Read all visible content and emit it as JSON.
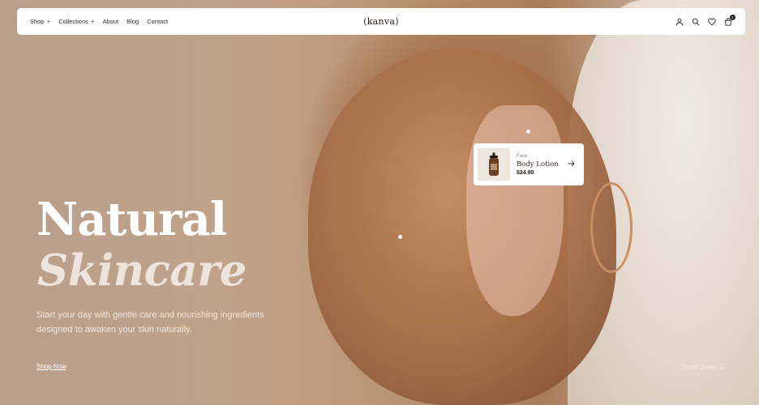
{
  "nav": {
    "logo": "(kanva)",
    "links": [
      {
        "label": "Shop",
        "has_submenu": true
      },
      {
        "label": "Collections",
        "has_submenu": true
      },
      {
        "label": "About",
        "has_submenu": false
      },
      {
        "label": "Blog",
        "has_submenu": false
      },
      {
        "label": "Contact",
        "has_submenu": false
      }
    ],
    "submenu_indicator": "+",
    "icons": [
      "user-icon",
      "search-icon",
      "heart-icon",
      "cart-icon"
    ],
    "cart_count": "1"
  },
  "hero": {
    "title_line1": "Natural",
    "title_line2": "Skincare",
    "subtitle": "Start your day with gentle care and nourishing ingredients designed to awaken your skin naturally.",
    "cta_label": "Shop Now",
    "scroll_label": "Scroll Down",
    "scroll_icon": "arrow-down-icon"
  },
  "product_card": {
    "category": "Face",
    "name": "Body Lotion",
    "price": "$24.90",
    "arrow_icon": "arrow-right-icon"
  },
  "colors": {
    "nav_bg": "#ffffff",
    "title_primary": "#ffffff",
    "title_italic": "#ece4dd",
    "text_dark": "#2a1f1a"
  }
}
